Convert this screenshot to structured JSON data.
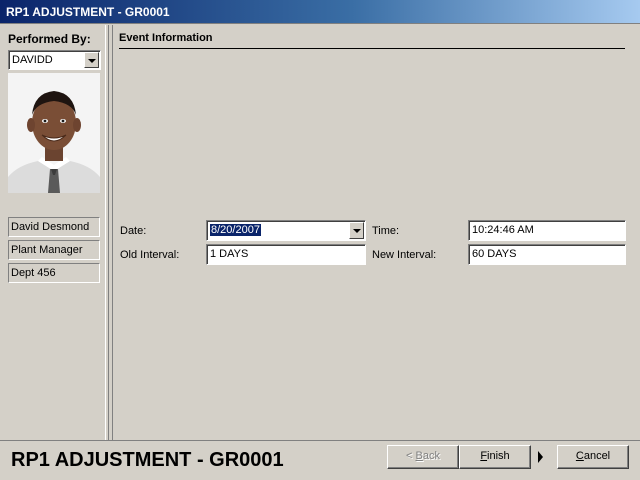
{
  "window": {
    "title": "RP1 ADJUSTMENT - GR0001"
  },
  "sidebar": {
    "performed_by_label": "Performed By:",
    "performed_by_value": "DAVIDD",
    "user_name": "David Desmond",
    "user_title": "Plant Manager",
    "user_dept": "Dept 456"
  },
  "event": {
    "section_title": "Event Information",
    "date_label": "Date:",
    "date_value": "8/20/2007",
    "time_label": "Time:",
    "time_value": "10:24:46 AM",
    "old_interval_label": "Old Interval:",
    "old_interval_value": "1 DAYS",
    "new_interval_label": "New Interval:",
    "new_interval_value": "60 DAYS"
  },
  "footer": {
    "title": "RP1 ADJUSTMENT - GR0001",
    "back_pre": "< ",
    "back_key": "B",
    "back_rest": "ack",
    "finish_key": "F",
    "finish_rest": "inish",
    "cancel_key": "C",
    "cancel_rest": "ancel"
  },
  "icons": {
    "dropdown": "chevron-down-icon",
    "wizard_arrow": "arrow-right-icon"
  }
}
